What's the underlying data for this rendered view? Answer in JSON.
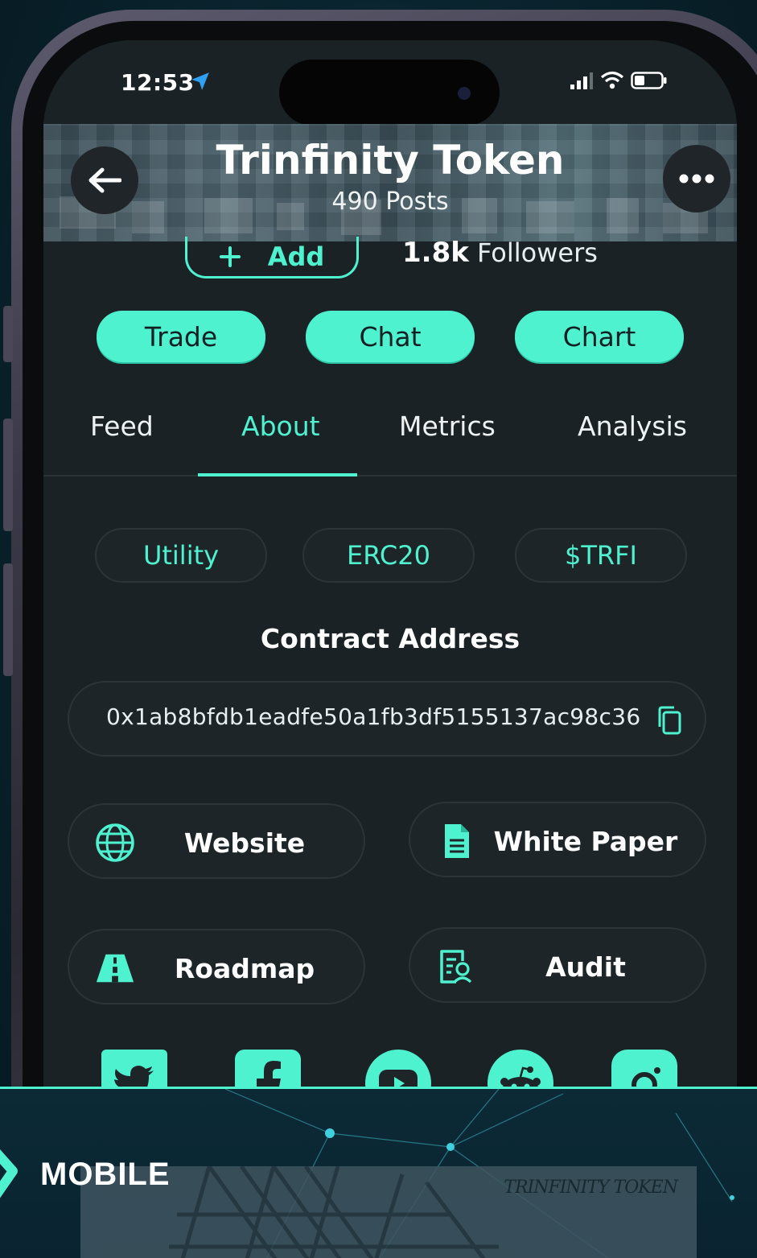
{
  "status_bar": {
    "time": "12:53"
  },
  "header": {
    "title": "Trinfinity Token",
    "posts": "490 Posts",
    "add_label": "Add",
    "followers_count": "1.8k",
    "followers_label": "Followers"
  },
  "actions": [
    {
      "label": "Trade"
    },
    {
      "label": "Chat"
    },
    {
      "label": "Chart"
    }
  ],
  "tabs": [
    {
      "label": "Feed",
      "active": false
    },
    {
      "label": "About",
      "active": true
    },
    {
      "label": "Metrics",
      "active": false
    },
    {
      "label": "Analysis",
      "active": false
    }
  ],
  "tags": [
    "Utility",
    "ERC20",
    "$TRFI"
  ],
  "contract": {
    "title": "Contract Address",
    "address": "0x1ab8bfdb1eadfe50a1fb3df5155137ac98c36"
  },
  "links": [
    {
      "label": "Website",
      "icon": "globe-icon"
    },
    {
      "label": "White Paper",
      "icon": "document-icon"
    },
    {
      "label": "Roadmap",
      "icon": "road-icon"
    },
    {
      "label": "Audit",
      "icon": "audit-icon"
    }
  ],
  "socials": [
    "twitter-icon",
    "facebook-icon",
    "youtube-icon",
    "reddit-icon",
    "instagram-icon"
  ],
  "footer": {
    "label": "MOBILE",
    "preview_text": "TRINFINITY TOKEN"
  },
  "colors": {
    "accent": "#4ef2cf",
    "screen_bg": "#1a2226",
    "card_bg": "#1d2529"
  }
}
